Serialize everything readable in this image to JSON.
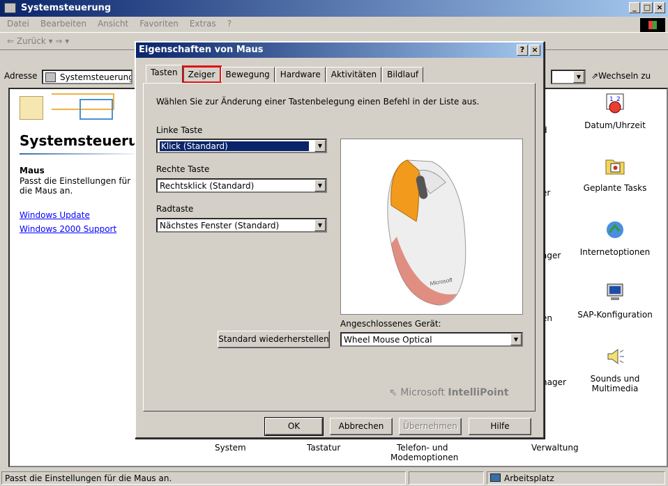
{
  "window": {
    "title": "Systemsteuerung",
    "min": "_",
    "max": "□",
    "close": "×"
  },
  "menu": [
    "Datei",
    "Bearbeiten",
    "Ansicht",
    "Favoriten",
    "Extras",
    "?"
  ],
  "toolbar": {
    "back": "⇐ Zurück ▾ ⇒ ▾"
  },
  "address": {
    "label": "Adresse",
    "value": "Systemsteuerung",
    "go": "⇗Wechseln zu"
  },
  "leftpane": {
    "title": "Systemsteuerung",
    "selected_name": "Maus",
    "selected_desc": "Passt die Einstellungen für die Maus an.",
    "links": [
      "Windows Update",
      "Windows 2000 Support"
    ]
  },
  "cp_items": [
    {
      "label": "Datum/Uhrzeit"
    },
    {
      "label": "Geplante Tasks"
    },
    {
      "label": "Internetoptionen"
    },
    {
      "label": "SAP-Konfiguration"
    },
    {
      "label": "Sounds und Multimedia"
    }
  ],
  "partial_labels": [
    "d",
    "er",
    "ager",
    "en",
    "hager"
  ],
  "bottom_labels": [
    "System",
    "Tastatur",
    "Telefon- und",
    "Modemoptionen",
    "Verwaltung"
  ],
  "status": {
    "text": "Passt die Einstellungen für die Maus an.",
    "zone": "Arbeitsplatz"
  },
  "dialog": {
    "title": "Eigenschaften von Maus",
    "help_btn": "?",
    "close_btn": "×",
    "tabs": [
      "Tasten",
      "Zeiger",
      "Bewegung",
      "Hardware",
      "Aktivitäten",
      "Bildlauf"
    ],
    "active_tab": "Tasten",
    "highlighted_tab": "Zeiger",
    "intro": "Wählen Sie zur Änderung einer Tastenbelegung einen Befehl in der Liste aus.",
    "left_label": "Linke Taste",
    "left_value": "Klick (Standard)",
    "right_label": "Rechte Taste",
    "right_value": "Rechtsklick (Standard)",
    "wheel_label": "Radtaste",
    "wheel_value": "Nächstes Fenster (Standard)",
    "reset": "Standard wiederherstellen",
    "device_label": "Angeschlossenes Gerät:",
    "device_value": "Wheel Mouse Optical",
    "brand_light": "Microsoft",
    "brand_bold": "IntelliPoint",
    "mouse_logo": "Microsoft",
    "ok": "OK",
    "cancel": "Abbrechen",
    "apply": "Übernehmen",
    "help": "Hilfe"
  },
  "colors": {
    "titlebar": "#0a246a",
    "highlight_tab": "#e01010",
    "mouse_button": "#f29a1c"
  }
}
